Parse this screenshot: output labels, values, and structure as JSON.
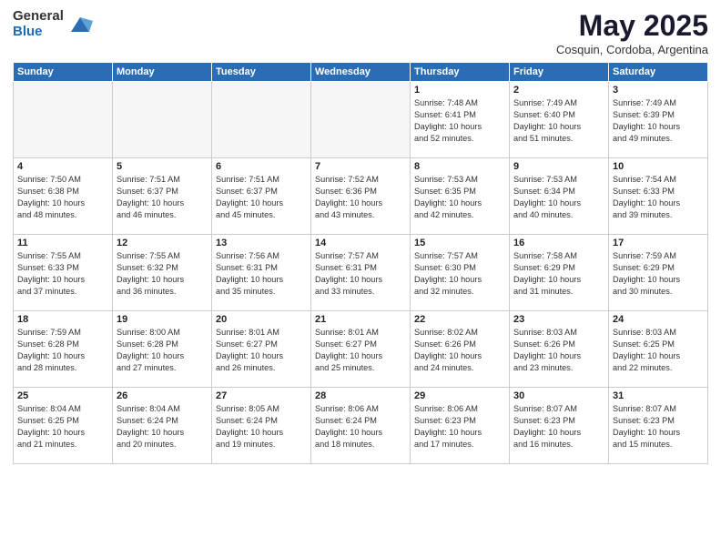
{
  "header": {
    "logo_general": "General",
    "logo_blue": "Blue",
    "month_title": "May 2025",
    "location": "Cosquin, Cordoba, Argentina"
  },
  "weekdays": [
    "Sunday",
    "Monday",
    "Tuesday",
    "Wednesday",
    "Thursday",
    "Friday",
    "Saturday"
  ],
  "weeks": [
    [
      {
        "num": "",
        "content": ""
      },
      {
        "num": "",
        "content": ""
      },
      {
        "num": "",
        "content": ""
      },
      {
        "num": "",
        "content": ""
      },
      {
        "num": "1",
        "content": "Sunrise: 7:48 AM\nSunset: 6:41 PM\nDaylight: 10 hours\nand 52 minutes."
      },
      {
        "num": "2",
        "content": "Sunrise: 7:49 AM\nSunset: 6:40 PM\nDaylight: 10 hours\nand 51 minutes."
      },
      {
        "num": "3",
        "content": "Sunrise: 7:49 AM\nSunset: 6:39 PM\nDaylight: 10 hours\nand 49 minutes."
      }
    ],
    [
      {
        "num": "4",
        "content": "Sunrise: 7:50 AM\nSunset: 6:38 PM\nDaylight: 10 hours\nand 48 minutes."
      },
      {
        "num": "5",
        "content": "Sunrise: 7:51 AM\nSunset: 6:37 PM\nDaylight: 10 hours\nand 46 minutes."
      },
      {
        "num": "6",
        "content": "Sunrise: 7:51 AM\nSunset: 6:37 PM\nDaylight: 10 hours\nand 45 minutes."
      },
      {
        "num": "7",
        "content": "Sunrise: 7:52 AM\nSunset: 6:36 PM\nDaylight: 10 hours\nand 43 minutes."
      },
      {
        "num": "8",
        "content": "Sunrise: 7:53 AM\nSunset: 6:35 PM\nDaylight: 10 hours\nand 42 minutes."
      },
      {
        "num": "9",
        "content": "Sunrise: 7:53 AM\nSunset: 6:34 PM\nDaylight: 10 hours\nand 40 minutes."
      },
      {
        "num": "10",
        "content": "Sunrise: 7:54 AM\nSunset: 6:33 PM\nDaylight: 10 hours\nand 39 minutes."
      }
    ],
    [
      {
        "num": "11",
        "content": "Sunrise: 7:55 AM\nSunset: 6:33 PM\nDaylight: 10 hours\nand 37 minutes."
      },
      {
        "num": "12",
        "content": "Sunrise: 7:55 AM\nSunset: 6:32 PM\nDaylight: 10 hours\nand 36 minutes."
      },
      {
        "num": "13",
        "content": "Sunrise: 7:56 AM\nSunset: 6:31 PM\nDaylight: 10 hours\nand 35 minutes."
      },
      {
        "num": "14",
        "content": "Sunrise: 7:57 AM\nSunset: 6:31 PM\nDaylight: 10 hours\nand 33 minutes."
      },
      {
        "num": "15",
        "content": "Sunrise: 7:57 AM\nSunset: 6:30 PM\nDaylight: 10 hours\nand 32 minutes."
      },
      {
        "num": "16",
        "content": "Sunrise: 7:58 AM\nSunset: 6:29 PM\nDaylight: 10 hours\nand 31 minutes."
      },
      {
        "num": "17",
        "content": "Sunrise: 7:59 AM\nSunset: 6:29 PM\nDaylight: 10 hours\nand 30 minutes."
      }
    ],
    [
      {
        "num": "18",
        "content": "Sunrise: 7:59 AM\nSunset: 6:28 PM\nDaylight: 10 hours\nand 28 minutes."
      },
      {
        "num": "19",
        "content": "Sunrise: 8:00 AM\nSunset: 6:28 PM\nDaylight: 10 hours\nand 27 minutes."
      },
      {
        "num": "20",
        "content": "Sunrise: 8:01 AM\nSunset: 6:27 PM\nDaylight: 10 hours\nand 26 minutes."
      },
      {
        "num": "21",
        "content": "Sunrise: 8:01 AM\nSunset: 6:27 PM\nDaylight: 10 hours\nand 25 minutes."
      },
      {
        "num": "22",
        "content": "Sunrise: 8:02 AM\nSunset: 6:26 PM\nDaylight: 10 hours\nand 24 minutes."
      },
      {
        "num": "23",
        "content": "Sunrise: 8:03 AM\nSunset: 6:26 PM\nDaylight: 10 hours\nand 23 minutes."
      },
      {
        "num": "24",
        "content": "Sunrise: 8:03 AM\nSunset: 6:25 PM\nDaylight: 10 hours\nand 22 minutes."
      }
    ],
    [
      {
        "num": "25",
        "content": "Sunrise: 8:04 AM\nSunset: 6:25 PM\nDaylight: 10 hours\nand 21 minutes."
      },
      {
        "num": "26",
        "content": "Sunrise: 8:04 AM\nSunset: 6:24 PM\nDaylight: 10 hours\nand 20 minutes."
      },
      {
        "num": "27",
        "content": "Sunrise: 8:05 AM\nSunset: 6:24 PM\nDaylight: 10 hours\nand 19 minutes."
      },
      {
        "num": "28",
        "content": "Sunrise: 8:06 AM\nSunset: 6:24 PM\nDaylight: 10 hours\nand 18 minutes."
      },
      {
        "num": "29",
        "content": "Sunrise: 8:06 AM\nSunset: 6:23 PM\nDaylight: 10 hours\nand 17 minutes."
      },
      {
        "num": "30",
        "content": "Sunrise: 8:07 AM\nSunset: 6:23 PM\nDaylight: 10 hours\nand 16 minutes."
      },
      {
        "num": "31",
        "content": "Sunrise: 8:07 AM\nSunset: 6:23 PM\nDaylight: 10 hours\nand 15 minutes."
      }
    ]
  ]
}
